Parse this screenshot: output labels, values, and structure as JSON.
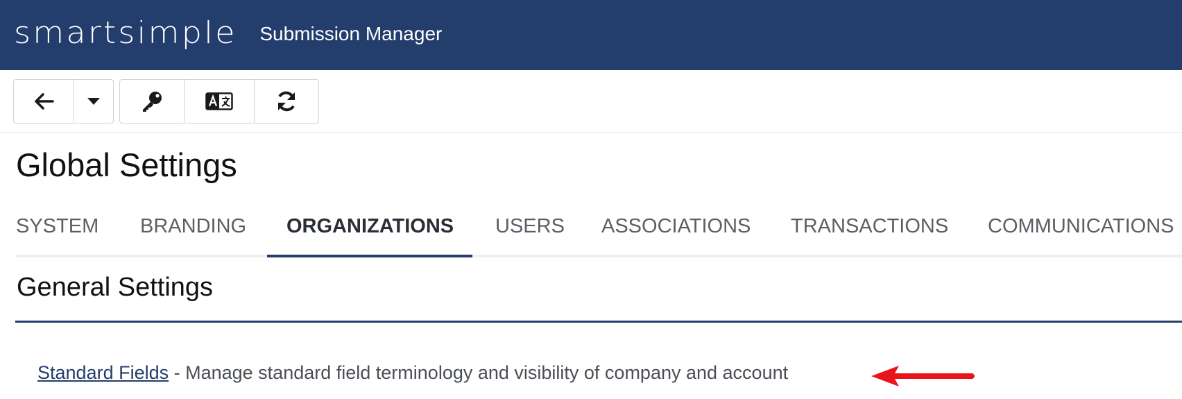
{
  "header": {
    "logo_text": "smartsimple",
    "app_title": "Submission Manager",
    "background_color": "#233d6c"
  },
  "toolbar": {
    "buttons": [
      {
        "name": "back",
        "icon": "arrow-left-icon"
      },
      {
        "name": "dropdown",
        "icon": "caret-down-icon"
      },
      {
        "name": "key",
        "icon": "key-icon"
      },
      {
        "name": "translate",
        "icon": "language-icon"
      },
      {
        "name": "refresh",
        "icon": "refresh-icon"
      }
    ]
  },
  "page": {
    "title": "Global Settings"
  },
  "tabs": [
    {
      "label": "SYSTEM",
      "active": false
    },
    {
      "label": "BRANDING",
      "active": false
    },
    {
      "label": "ORGANIZATIONS",
      "active": true
    },
    {
      "label": "USERS",
      "active": false
    },
    {
      "label": "ASSOCIATIONS",
      "active": false
    },
    {
      "label": "TRANSACTIONS",
      "active": false
    },
    {
      "label": "COMMUNICATIONS",
      "active": false
    }
  ],
  "section": {
    "title": "General Settings",
    "items": [
      {
        "link_label": "Standard Fields",
        "description": " - Manage standard field terminology and visibility of company and account"
      }
    ]
  },
  "annotation": {
    "icon": "red-arrow-icon",
    "color": "#e8141c"
  }
}
